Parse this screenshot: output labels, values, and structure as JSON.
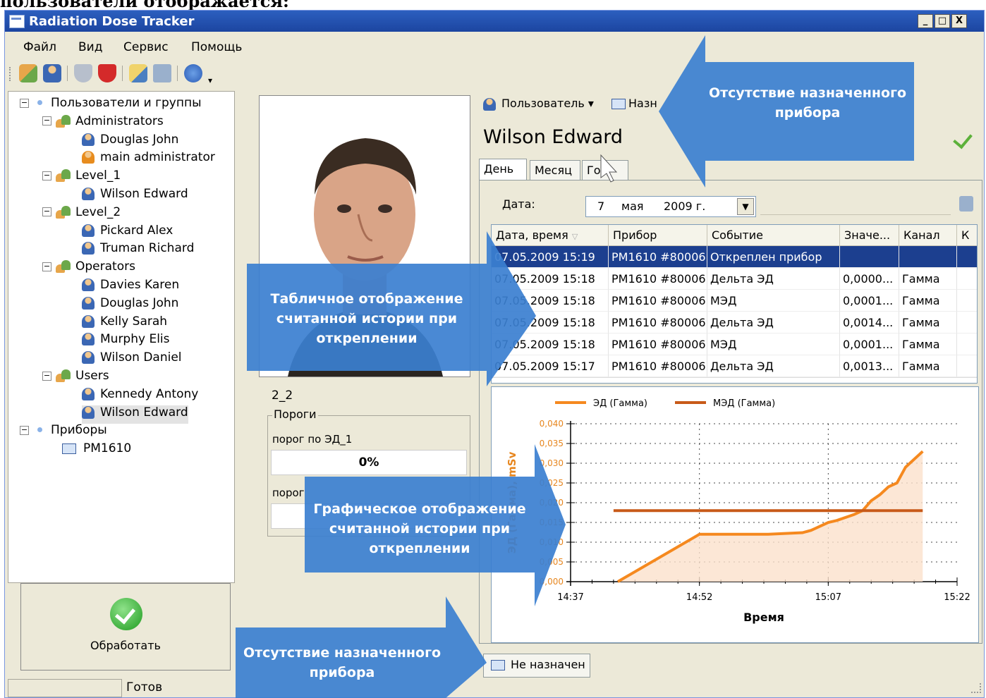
{
  "page_caption": "пользователи отображается:",
  "window": {
    "title": "Radiation Dose Tracker",
    "min": "_",
    "max": "□",
    "close": "X"
  },
  "menu": [
    "Файл",
    "Вид",
    "Сервис",
    "Помощь"
  ],
  "tree": {
    "root_users": "Пользователи и группы",
    "groups": [
      {
        "name": "Administrators",
        "users": [
          "Douglas John",
          "main administrator"
        ]
      },
      {
        "name": "Level_1",
        "users": [
          "Wilson Edward"
        ]
      },
      {
        "name": "Level_2",
        "users": [
          "Pickard Alex",
          "Truman Richard"
        ]
      },
      {
        "name": "Operators",
        "users": [
          "Davies Karen",
          "Douglas John",
          "Kelly Sarah",
          "Murphy Elis",
          "Wilson Daniel"
        ]
      },
      {
        "name": "Users",
        "users": [
          "Kennedy Antony",
          "Wilson Edward"
        ]
      }
    ],
    "root_devices": "Приборы",
    "devices": [
      "PM1610"
    ],
    "expander": "−"
  },
  "process_button": "Обработать",
  "status": {
    "text": "Готов"
  },
  "profile": {
    "id_label": "2_2",
    "thresholds_title": "Пороги",
    "threshold1_label": "порог по ЭД_1",
    "threshold1_value": "0%",
    "threshold2_label": "порог"
  },
  "right_toolbar": {
    "user_menu": "Пользователь",
    "assign": "Назн"
  },
  "user_name": "Wilson Edward",
  "tabs": [
    "День",
    "Месяц",
    "Год"
  ],
  "date": {
    "label": "Дата:",
    "day": "7",
    "month": "мая",
    "year": "2009 г."
  },
  "table": {
    "columns": [
      "Дата, время",
      "Прибор",
      "Событие",
      "Значе...",
      "Канал",
      "К"
    ],
    "rows": [
      [
        "07.05.2009 15:19",
        "PM1610 #80006",
        "Откреплен прибор",
        "",
        ""
      ],
      [
        "07.05.2009 15:18",
        "PM1610 #80006",
        "Дельта ЭД",
        "0,0000...",
        "Гамма"
      ],
      [
        "07.05.2009 15:18",
        "PM1610 #80006",
        "МЭД",
        "0,0001...",
        "Гамма"
      ],
      [
        "07.05.2009 15:18",
        "PM1610 #80006",
        "Дельта ЭД",
        "0,0014...",
        "Гамма"
      ],
      [
        "07.05.2009 15:18",
        "PM1610 #80006",
        "МЭД",
        "0,0001...",
        "Гамма"
      ],
      [
        "07.05.2009 15:17",
        "PM1610 #80006",
        "Дельта ЭД",
        "0,0013...",
        "Гамма"
      ]
    ]
  },
  "chart_data": {
    "type": "line",
    "xlabel": "Время",
    "ylabel": "ЭД (Гамма), mSv",
    "x_ticks": [
      "14:37",
      "14:52",
      "15:07",
      "15:22"
    ],
    "y_ticks": [
      "0,040",
      "0,035",
      "0,030",
      "0,025",
      "0,020",
      "0,015",
      "0,010",
      "0,005",
      "0,000"
    ],
    "ylim": [
      0,
      0.04
    ],
    "grid": true,
    "legend_position": "top",
    "series": [
      {
        "name": "ЭД (Гамма)",
        "color": "#f5891f",
        "area": true,
        "x": [
          42.5,
          52,
          60,
          62,
          64,
          65,
          65.5,
          67,
          68,
          70,
          71,
          72,
          73,
          74,
          75,
          76,
          78
        ],
        "y": [
          0,
          0.012,
          0.012,
          0.0122,
          0.0124,
          0.013,
          0.0135,
          0.015,
          0.0155,
          0.017,
          0.018,
          0.0205,
          0.022,
          0.024,
          0.025,
          0.029,
          0.033
        ]
      },
      {
        "name": "МЭД (Гамма)",
        "color": "#c85a19",
        "area": false,
        "x": [
          42,
          78
        ],
        "y": [
          0.018,
          0.018
        ]
      }
    ]
  },
  "callouts": [
    "Отсутствие назначенного прибора",
    "Табличное отображение считанной истории при откреплении",
    "Графическое отображение считанной истории при откреплении",
    "Отсутствие назначенного прибора"
  ],
  "bottom_tab": "Не назначен"
}
